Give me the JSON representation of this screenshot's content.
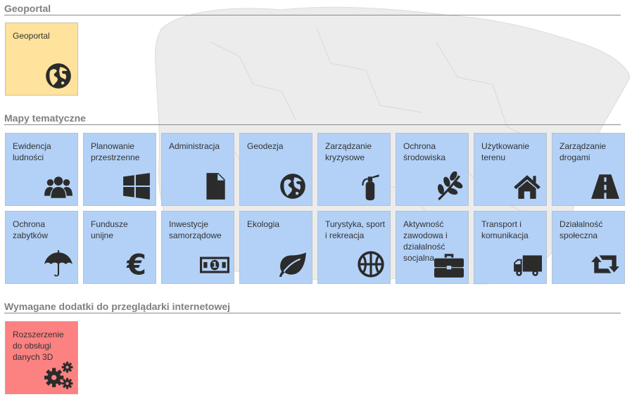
{
  "sections": {
    "geoportal": "Geoportal",
    "thematic": "Mapy tematyczne",
    "addons": "Wymagane dodatki do przeglądarki internetowej"
  },
  "geoportal_tile": {
    "label": "Geoportal",
    "icon": "globe-icon"
  },
  "thematic_tiles": [
    {
      "label": "Ewidencja ludności",
      "icon": "users-icon"
    },
    {
      "label": "Planowanie przestrzenne",
      "icon": "windows-icon"
    },
    {
      "label": "Administracja",
      "icon": "document-icon"
    },
    {
      "label": "Geodezja",
      "icon": "globe-icon"
    },
    {
      "label": "Zarządzanie kryzysowe",
      "icon": "fire-extinguisher-icon"
    },
    {
      "label": "Ochrona środowiska",
      "icon": "plant-icon"
    },
    {
      "label": "Użytkowanie terenu",
      "icon": "home-icon"
    },
    {
      "label": "Zarządzanie drogami",
      "icon": "road-icon"
    },
    {
      "label": "Ochrona zabytków",
      "icon": "umbrella-icon"
    },
    {
      "label": "Fundusze unijne",
      "icon": "euro-icon"
    },
    {
      "label": "Inwestycje samorządowe",
      "icon": "money-icon"
    },
    {
      "label": "Ekologia",
      "icon": "leaf-icon"
    },
    {
      "label": "Turystyka, sport i rekreacja",
      "icon": "basketball-icon"
    },
    {
      "label": "Aktywność zawodowa i działalność socjalna",
      "icon": "briefcase-icon"
    },
    {
      "label": "Transport i komunikacja",
      "icon": "truck-icon"
    },
    {
      "label": "Działalność społeczna",
      "icon": "retweet-icon"
    }
  ],
  "addon_tile": {
    "label": "Rozszerzenie do obsługi danych 3D",
    "icon": "gears-icon"
  },
  "colors": {
    "geoportal_tile": "#ffe29c",
    "thematic_tile": "#b3d1f7",
    "addon_tile": "#fc8181",
    "icon": "#2b2b2b",
    "section_title": "#808080"
  }
}
